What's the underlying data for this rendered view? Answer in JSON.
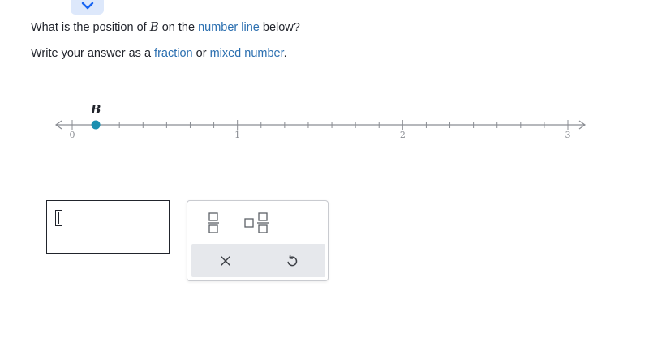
{
  "question": {
    "line1_prefix": "What is the position of ",
    "line1_var": "B",
    "line1_mid": " on the ",
    "line1_link": "number line",
    "line1_suffix": " below?",
    "line2_prefix": "Write your answer as a ",
    "line2_link1": "fraction",
    "line2_mid": " or ",
    "line2_link2": "mixed number",
    "line2_suffix": "."
  },
  "number_line": {
    "ticks": [
      "0",
      "1",
      "2",
      "3"
    ],
    "min": 0,
    "max": 3,
    "subdivisions_per_unit": 7,
    "point_label": "B",
    "point_value": 0.1428,
    "point_color": "#1b8fb0"
  },
  "answer": {
    "value": ""
  },
  "keypad": {
    "keys": [
      "fraction-key",
      "mixed-number-key",
      "clear-key",
      "undo-key"
    ]
  },
  "colors": {
    "link": "#2b6fb0",
    "axis": "#8a8d93",
    "point": "#1b8fb0"
  }
}
